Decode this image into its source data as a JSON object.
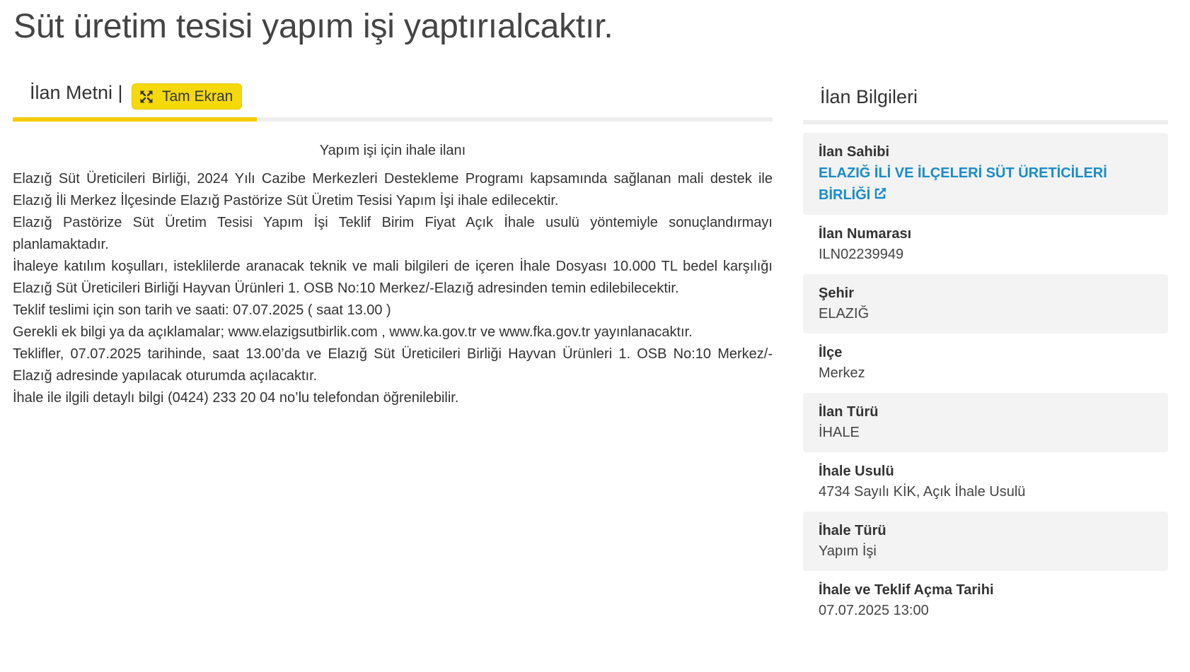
{
  "page": {
    "title": "Süt üretim tesisi yapım işi yaptırıalcaktır."
  },
  "tabs": {
    "label": "İlan Metni |",
    "fullscreen_label": "Tam Ekran",
    "fullscreen_icon": "expand-icon"
  },
  "ad": {
    "heading": "Yapım işi için ihale ilanı",
    "paragraphs": [
      "Elazığ Süt Üreticileri Birliği, 2024 Yılı Cazibe Merkezleri Destekleme Programı kapsamında sağlanan mali destek ile Elazığ İli Merkez İlçesinde  Elazığ Pastörize Süt  Üretim Tesisi Yapım İşi ihale edilecektir.",
      "Elazığ Pastörize Süt  Üretim Tesisi Yapım İşi Teklif Birim Fiyat Açık İhale usulü yöntemiyle sonuçlandırmayı planlamaktadır.",
      "İhaleye katılım koşulları, isteklilerde aranacak teknik ve mali bilgileri de içeren İhale Dosyası 10.000 TL bedel karşılığı Elazığ Süt Üreticileri Birliği Hayvan Ürünleri 1. OSB No:10 Merkez/-Elazığ  adresinden temin edilebilecektir.",
      "Teklif teslimi için son tarih ve saati: 07.07.2025 ( saat 13.00 )",
      "Gerekli ek bilgi ya da açıklamalar; www.elazigsutbirlik.com , www.ka.gov.tr ve www.fka.gov.tr  yayınlanacaktır.",
      "Teklifler, 07.07.2025 tarihinde, saat 13.00’da ve Elazığ Süt Üreticileri Birliği Hayvan Ürünleri 1. OSB No:10 Merkez/-Elazığ  adresinde yapılacak oturumda açılacaktır.",
      "İhale ile ilgili detaylı bilgi (0424) 233 20 04  no’lu telefondan öğrenilebilir."
    ]
  },
  "sidebar": {
    "title": "İlan Bilgileri",
    "owner": {
      "label": "İlan Sahibi",
      "value": "ELAZIĞ İLİ VE İLÇELERİ SÜT ÜRETİCİLERİ BİRLİĞİ",
      "icon": "external-link-icon",
      "link_color": "#1a8cc7"
    },
    "items": [
      {
        "label": "İlan Numarası",
        "value": "ILN02239949"
      },
      {
        "label": "Şehir",
        "value": "ELAZIĞ"
      },
      {
        "label": "İlçe",
        "value": "Merkez"
      },
      {
        "label": "İlan Türü",
        "value": "İHALE"
      },
      {
        "label": "İhale Usulü",
        "value": "4734 Sayılı KİK, Açık İhale Usulü"
      },
      {
        "label": "İhale Türü",
        "value": "Yapım İşi"
      },
      {
        "label": "İhale ve Teklif Açma Tarihi",
        "value": "07.07.2025 13:00"
      }
    ]
  },
  "colors": {
    "accent": "#f5cc00",
    "button": "#f5d90a",
    "panel": "#f3f3f3",
    "link": "#1a8cc7"
  }
}
